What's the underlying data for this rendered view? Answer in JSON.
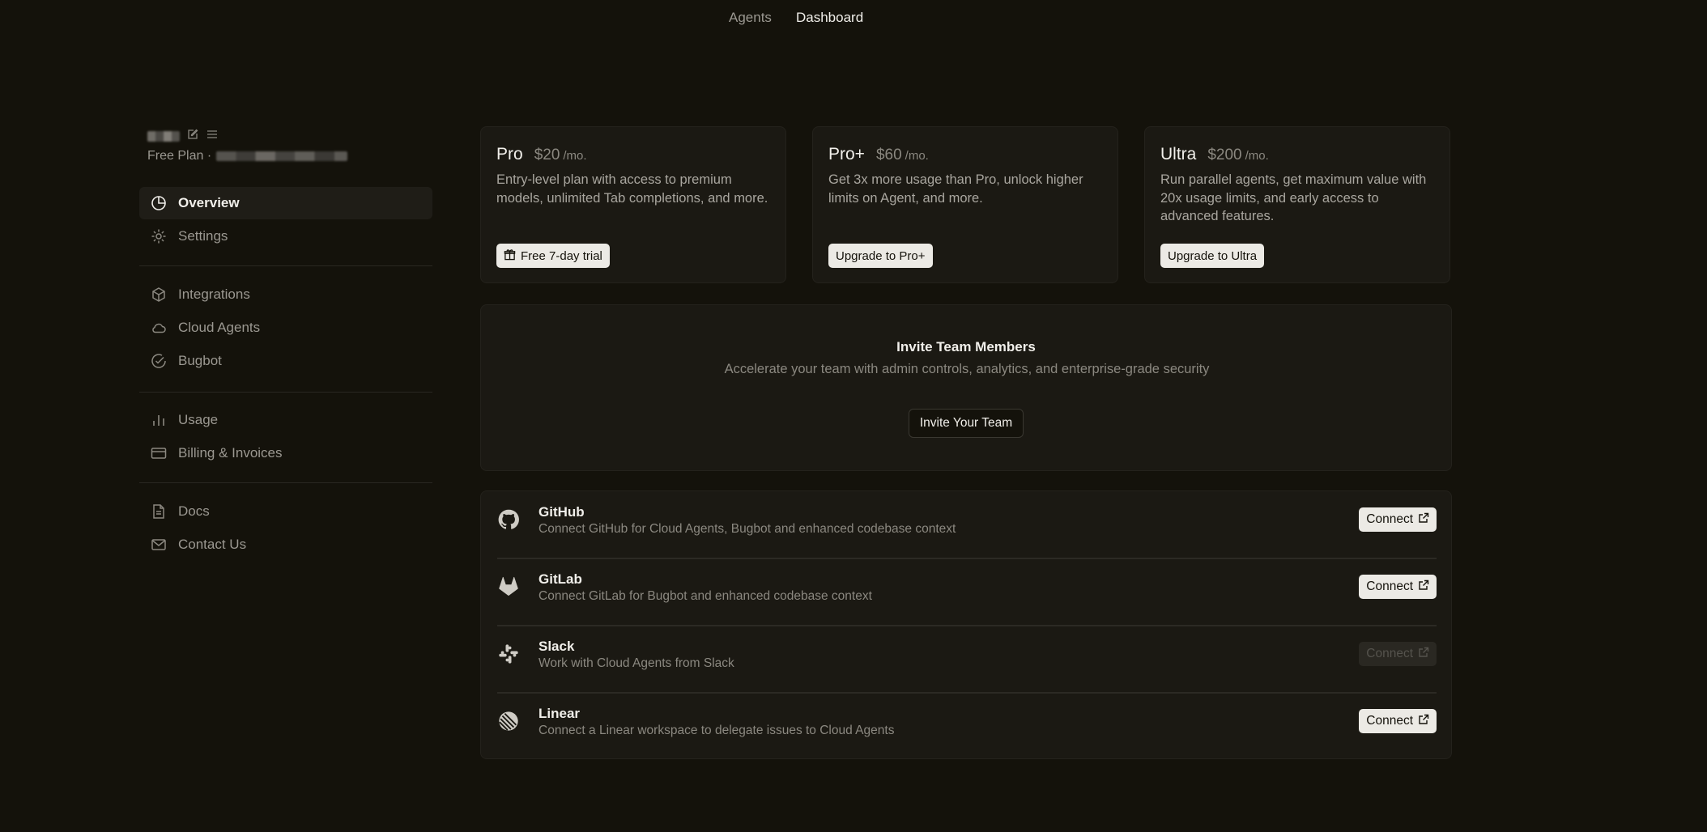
{
  "topnav": {
    "agents_label": "Agents",
    "dashboard_label": "Dashboard"
  },
  "account": {
    "plan_label": "Free Plan ·"
  },
  "sidebar": {
    "items": [
      {
        "label": "Overview",
        "icon": "pie-chart-icon",
        "active": true
      },
      {
        "label": "Settings",
        "icon": "gear-icon"
      },
      {
        "label": "Integrations",
        "icon": "cube-icon"
      },
      {
        "label": "Cloud Agents",
        "icon": "cloud-icon"
      },
      {
        "label": "Bugbot",
        "icon": "check-circle-icon"
      },
      {
        "label": "Usage",
        "icon": "bar-chart-icon"
      },
      {
        "label": "Billing & Invoices",
        "icon": "credit-card-icon"
      },
      {
        "label": "Docs",
        "icon": "document-icon"
      },
      {
        "label": "Contact Us",
        "icon": "mail-icon"
      }
    ]
  },
  "plans": [
    {
      "name": "Pro",
      "price": "$20",
      "per": "/mo.",
      "desc": "Entry-level plan with access to premium models, unlimited Tab completions, and more.",
      "button": "Free 7-day trial",
      "button_icon": "gift-icon"
    },
    {
      "name": "Pro+",
      "price": "$60",
      "per": "/mo.",
      "desc": "Get 3x more usage than Pro, unlock higher limits on Agent, and more.",
      "button": "Upgrade to Pro+"
    },
    {
      "name": "Ultra",
      "price": "$200",
      "per": "/mo.",
      "desc": "Run parallel agents, get maximum value with 20x usage limits, and early access to advanced features.",
      "button": "Upgrade to Ultra"
    }
  ],
  "invite": {
    "title": "Invite Team Members",
    "subtitle": "Accelerate your team with admin controls, analytics, and enterprise-grade security",
    "button": "Invite Your Team"
  },
  "integrations": [
    {
      "name": "GitHub",
      "desc": "Connect GitHub for Cloud Agents, Bugbot and enhanced codebase context",
      "button": "Connect",
      "icon": "github-icon",
      "enabled": true
    },
    {
      "name": "GitLab",
      "desc": "Connect GitLab for Bugbot and enhanced codebase context",
      "button": "Connect",
      "icon": "gitlab-icon",
      "enabled": true
    },
    {
      "name": "Slack",
      "desc": "Work with Cloud Agents from Slack",
      "button": "Connect",
      "icon": "slack-icon",
      "enabled": false
    },
    {
      "name": "Linear",
      "desc": "Connect a Linear workspace to delegate issues to Cloud Agents",
      "button": "Connect",
      "icon": "linear-icon",
      "enabled": true
    }
  ],
  "colors": {
    "background": "#14120b",
    "card": "#1b1913",
    "button_light": "#eceae5",
    "text_primary": "#f1efea",
    "text_muted": "#8b8880"
  }
}
